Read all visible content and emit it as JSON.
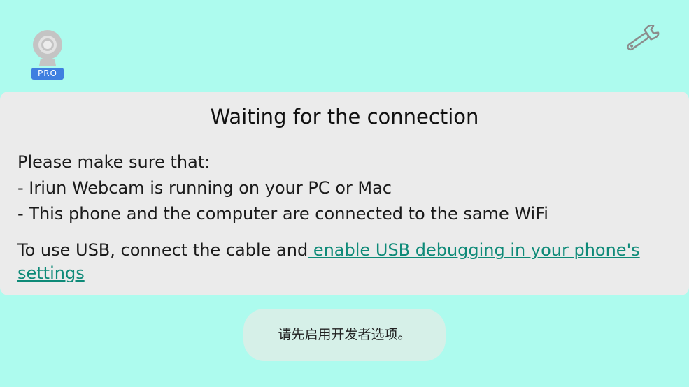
{
  "app": {
    "logo_icon": "webcam-icon",
    "badge": "PRO",
    "settings_icon": "wrench-icon"
  },
  "card": {
    "title": "Waiting for the connection",
    "lines": [
      "Please make sure that:",
      "- Iriun Webcam is running on your PC or Mac",
      "- This phone and the computer are connected to the same WiFi"
    ],
    "usb_text": "To use USB, connect the cable and",
    "usb_link": " enable USB debugging in your phone's settings"
  },
  "toast": {
    "message": "请先启用开发者选项。"
  },
  "colors": {
    "background": "#adfbee",
    "card": "#ebebeb",
    "link": "#0e8a78",
    "badge": "#3f7fe0"
  }
}
